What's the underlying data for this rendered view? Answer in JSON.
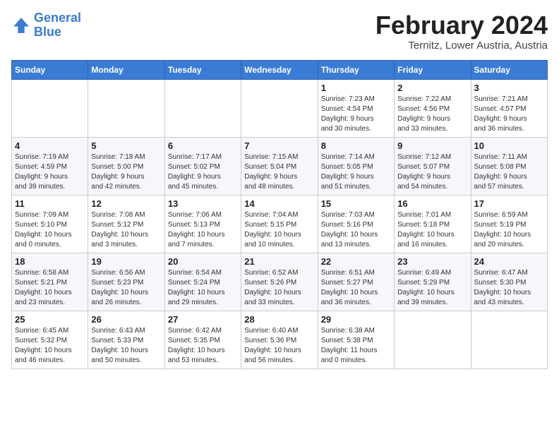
{
  "header": {
    "logo_line1": "General",
    "logo_line2": "Blue",
    "title": "February 2024",
    "subtitle": "Ternitz, Lower Austria, Austria"
  },
  "days_of_week": [
    "Sunday",
    "Monday",
    "Tuesday",
    "Wednesday",
    "Thursday",
    "Friday",
    "Saturday"
  ],
  "weeks": [
    [
      {
        "day": "",
        "info": ""
      },
      {
        "day": "",
        "info": ""
      },
      {
        "day": "",
        "info": ""
      },
      {
        "day": "",
        "info": ""
      },
      {
        "day": "1",
        "info": "Sunrise: 7:23 AM\nSunset: 4:54 PM\nDaylight: 9 hours\nand 30 minutes."
      },
      {
        "day": "2",
        "info": "Sunrise: 7:22 AM\nSunset: 4:56 PM\nDaylight: 9 hours\nand 33 minutes."
      },
      {
        "day": "3",
        "info": "Sunrise: 7:21 AM\nSunset: 4:57 PM\nDaylight: 9 hours\nand 36 minutes."
      }
    ],
    [
      {
        "day": "4",
        "info": "Sunrise: 7:19 AM\nSunset: 4:59 PM\nDaylight: 9 hours\nand 39 minutes."
      },
      {
        "day": "5",
        "info": "Sunrise: 7:18 AM\nSunset: 5:00 PM\nDaylight: 9 hours\nand 42 minutes."
      },
      {
        "day": "6",
        "info": "Sunrise: 7:17 AM\nSunset: 5:02 PM\nDaylight: 9 hours\nand 45 minutes."
      },
      {
        "day": "7",
        "info": "Sunrise: 7:15 AM\nSunset: 5:04 PM\nDaylight: 9 hours\nand 48 minutes."
      },
      {
        "day": "8",
        "info": "Sunrise: 7:14 AM\nSunset: 5:05 PM\nDaylight: 9 hours\nand 51 minutes."
      },
      {
        "day": "9",
        "info": "Sunrise: 7:12 AM\nSunset: 5:07 PM\nDaylight: 9 hours\nand 54 minutes."
      },
      {
        "day": "10",
        "info": "Sunrise: 7:11 AM\nSunset: 5:08 PM\nDaylight: 9 hours\nand 57 minutes."
      }
    ],
    [
      {
        "day": "11",
        "info": "Sunrise: 7:09 AM\nSunset: 5:10 PM\nDaylight: 10 hours\nand 0 minutes."
      },
      {
        "day": "12",
        "info": "Sunrise: 7:08 AM\nSunset: 5:12 PM\nDaylight: 10 hours\nand 3 minutes."
      },
      {
        "day": "13",
        "info": "Sunrise: 7:06 AM\nSunset: 5:13 PM\nDaylight: 10 hours\nand 7 minutes."
      },
      {
        "day": "14",
        "info": "Sunrise: 7:04 AM\nSunset: 5:15 PM\nDaylight: 10 hours\nand 10 minutes."
      },
      {
        "day": "15",
        "info": "Sunrise: 7:03 AM\nSunset: 5:16 PM\nDaylight: 10 hours\nand 13 minutes."
      },
      {
        "day": "16",
        "info": "Sunrise: 7:01 AM\nSunset: 5:18 PM\nDaylight: 10 hours\nand 16 minutes."
      },
      {
        "day": "17",
        "info": "Sunrise: 6:59 AM\nSunset: 5:19 PM\nDaylight: 10 hours\nand 20 minutes."
      }
    ],
    [
      {
        "day": "18",
        "info": "Sunrise: 6:58 AM\nSunset: 5:21 PM\nDaylight: 10 hours\nand 23 minutes."
      },
      {
        "day": "19",
        "info": "Sunrise: 6:56 AM\nSunset: 5:23 PM\nDaylight: 10 hours\nand 26 minutes."
      },
      {
        "day": "20",
        "info": "Sunrise: 6:54 AM\nSunset: 5:24 PM\nDaylight: 10 hours\nand 29 minutes."
      },
      {
        "day": "21",
        "info": "Sunrise: 6:52 AM\nSunset: 5:26 PM\nDaylight: 10 hours\nand 33 minutes."
      },
      {
        "day": "22",
        "info": "Sunrise: 6:51 AM\nSunset: 5:27 PM\nDaylight: 10 hours\nand 36 minutes."
      },
      {
        "day": "23",
        "info": "Sunrise: 6:49 AM\nSunset: 5:29 PM\nDaylight: 10 hours\nand 39 minutes."
      },
      {
        "day": "24",
        "info": "Sunrise: 6:47 AM\nSunset: 5:30 PM\nDaylight: 10 hours\nand 43 minutes."
      }
    ],
    [
      {
        "day": "25",
        "info": "Sunrise: 6:45 AM\nSunset: 5:32 PM\nDaylight: 10 hours\nand 46 minutes."
      },
      {
        "day": "26",
        "info": "Sunrise: 6:43 AM\nSunset: 5:33 PM\nDaylight: 10 hours\nand 50 minutes."
      },
      {
        "day": "27",
        "info": "Sunrise: 6:42 AM\nSunset: 5:35 PM\nDaylight: 10 hours\nand 53 minutes."
      },
      {
        "day": "28",
        "info": "Sunrise: 6:40 AM\nSunset: 5:36 PM\nDaylight: 10 hours\nand 56 minutes."
      },
      {
        "day": "29",
        "info": "Sunrise: 6:38 AM\nSunset: 5:38 PM\nDaylight: 11 hours\nand 0 minutes."
      },
      {
        "day": "",
        "info": ""
      },
      {
        "day": "",
        "info": ""
      }
    ]
  ]
}
